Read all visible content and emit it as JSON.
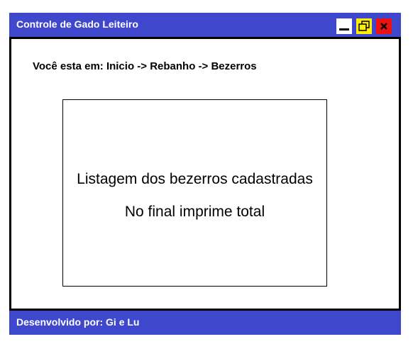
{
  "window": {
    "title": "Controle de Gado Leiteiro"
  },
  "title_controls": {
    "minimize_icon": "minimize-icon",
    "restore_icon": "restore-icon",
    "close_icon": "close-icon"
  },
  "breadcrumb": {
    "text": "Você esta em: Inicio -> Rebanho -> Bezerros"
  },
  "listing": {
    "line1": "Listagem dos bezerros cadastradas",
    "line2": "No final imprime total"
  },
  "footer": {
    "text": "Desenvolvido por: Gi e Lu"
  },
  "colors": {
    "titlebar": "#3f48cc",
    "minimize_bg": "#ffffff",
    "restore_bg": "#ffee00",
    "close_bg": "#ee1111"
  }
}
